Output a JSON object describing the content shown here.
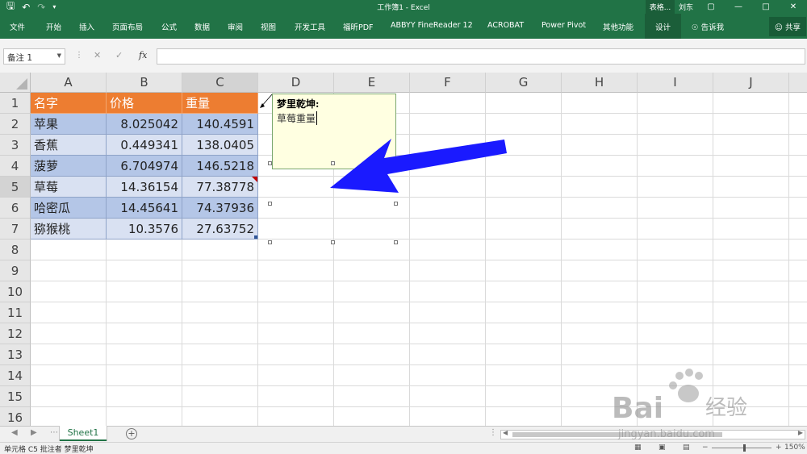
{
  "window": {
    "title": "工作簿1 - Excel",
    "context_tab": "表格...",
    "user": "刘东"
  },
  "ribbon": {
    "tabs": [
      "文件",
      "开始",
      "插入",
      "页面布局",
      "公式",
      "数据",
      "审阅",
      "视图",
      "开发工具",
      "福昕PDF",
      "ABBYY FineReader 12",
      "ACROBAT",
      "Power Pivot",
      "其他功能"
    ],
    "active_tab": "设计",
    "tell_me": "告诉我",
    "share": "共享"
  },
  "formula_bar": {
    "name_box": "备注 1",
    "fx": "fx",
    "value": ""
  },
  "columns": [
    "A",
    "B",
    "C",
    "D",
    "E",
    "F",
    "G",
    "H",
    "I",
    "J"
  ],
  "rows": [
    "1",
    "2",
    "3",
    "4",
    "5",
    "6",
    "7",
    "8",
    "9",
    "10",
    "11",
    "12",
    "13",
    "14",
    "15",
    "16"
  ],
  "table": {
    "headers": [
      "名字",
      "价格",
      "重量"
    ],
    "rows": [
      [
        "苹果",
        "8.025042",
        "140.4591"
      ],
      [
        "香蕉",
        "0.449341",
        "138.0405"
      ],
      [
        "菠萝",
        "6.704974",
        "146.5218"
      ],
      [
        "草莓",
        "14.36154",
        "77.38778"
      ],
      [
        "哈密瓜",
        "14.45641",
        "74.37936"
      ],
      [
        "猕猴桃",
        "10.3576",
        "27.63752"
      ]
    ]
  },
  "comment": {
    "author": "梦里乾坤:",
    "text": "草莓重量"
  },
  "sheet_tabs": {
    "active": "Sheet1",
    "add": "+"
  },
  "status_bar": {
    "message": "单元格 C5 批注者 梦里乾坤",
    "zoom": "150%"
  },
  "watermark": {
    "brand": "Bai",
    "brand_cn": "经验",
    "url": "jingyan.baidu.com"
  },
  "colors": {
    "excel_green": "#217346",
    "header_orange": "#ed7d31",
    "band_dark": "#b4c6e7",
    "band_light": "#d9e1f2",
    "comment_bg": "#ffffe1",
    "arrow_blue": "#1a1aff"
  }
}
